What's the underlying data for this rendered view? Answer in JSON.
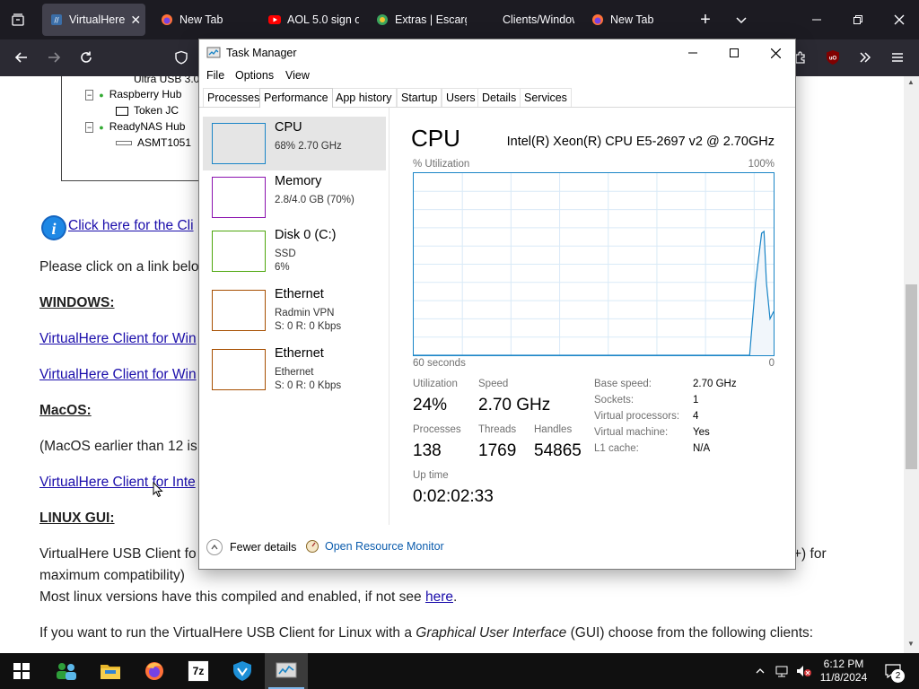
{
  "browser": {
    "tabs": [
      {
        "label": "VirtualHere",
        "icon": "virtualhere-icon",
        "active": true
      },
      {
        "label": "New Tab",
        "icon": "firefox-icon"
      },
      {
        "label": "AOL 5.0 sign o",
        "icon": "youtube-icon"
      },
      {
        "label": "Extras | Escarg",
        "icon": "escargot-icon"
      },
      {
        "label": "Clients/Windows ·",
        "icon": ""
      },
      {
        "label": "New Tab",
        "icon": "firefox-icon"
      }
    ]
  },
  "page": {
    "tree": [
      {
        "label": "Ultra USB 3.0",
        "indent": 2
      },
      {
        "label": "Raspberry Hub",
        "indent": 1
      },
      {
        "label": "Token JC",
        "indent": 2
      },
      {
        "label": "ReadyNAS Hub",
        "indent": 1
      },
      {
        "label": "ASMT1051",
        "indent": 2
      }
    ],
    "info_link": "Click here for the Cli",
    "intro": "Please click on a link belo",
    "windows_heading": "WINDOWS:",
    "win_link1": "VirtualHere Client for Win",
    "win_link2": "VirtualHere Client for Win",
    "mac_heading": "MacOS:",
    "mac_note": "(MacOS earlier than 12 is",
    "mac_link": "VirtualHere Client for Inte",
    "linux_heading": "LINUX GUI:",
    "linux_line1_start": "VirtualHere USB Client fo",
    "linux_line1_end": "+) for",
    "linux_line2": "maximum compatibility)",
    "linux_line3": "Most linux versions have this compiled and enabled, if not see",
    "here_link": "here",
    "linux_line3_end": ".",
    "gui_line_a": "If you want to run the VirtualHere USB Client for Linux with a",
    "gui_line_em": "Graphical User Interface",
    "gui_line_b": "(GUI) choose from the following clients:"
  },
  "taskmanager": {
    "title": "Task Manager",
    "menu": [
      "File",
      "Options",
      "View"
    ],
    "tabs": [
      "Processes",
      "Performance",
      "App history",
      "Startup",
      "Users",
      "Details",
      "Services"
    ],
    "selected_tab": "Performance",
    "sidebar": [
      {
        "name": "CPU",
        "sub1": "68%  2.70 GHz",
        "sub2": "",
        "color": "#1a85c7",
        "selected": true
      },
      {
        "name": "Memory",
        "sub1": "2.8/4.0 GB (70%)",
        "sub2": "",
        "color": "#8b12ae"
      },
      {
        "name": "Disk 0 (C:)",
        "sub1": "SSD",
        "sub2": "6%",
        "color": "#4da60c"
      },
      {
        "name": "Ethernet",
        "sub1": "Radmin VPN",
        "sub2": "S: 0  R: 0 Kbps",
        "color": "#a74f01"
      },
      {
        "name": "Ethernet",
        "sub1": "Ethernet",
        "sub2": "S: 0  R: 0 Kbps",
        "color": "#a74f01"
      }
    ],
    "cpu": {
      "heading": "CPU",
      "model": "Intel(R) Xeon(R) CPU E5-2697 v2 @ 2.70GHz",
      "graph_label": "% Utilization",
      "graph_max": "100%",
      "graph_left": "60 seconds",
      "graph_right": "0",
      "utilization_label": "Utilization",
      "utilization": "24%",
      "speed_label": "Speed",
      "speed": "2.70 GHz",
      "processes_label": "Processes",
      "processes": "138",
      "threads_label": "Threads",
      "threads": "1769",
      "handles_label": "Handles",
      "handles": "54865",
      "uptime_label": "Up time",
      "uptime": "0:02:02:33",
      "details": [
        {
          "k": "Base speed:",
          "v": "2.70 GHz"
        },
        {
          "k": "Sockets:",
          "v": "1"
        },
        {
          "k": "Virtual processors:",
          "v": "4"
        },
        {
          "k": "Virtual machine:",
          "v": "Yes"
        },
        {
          "k": "L1 cache:",
          "v": "N/A"
        }
      ]
    },
    "fewer_details": "Fewer details",
    "open_monitor": "Open Resource Monitor"
  },
  "chart_data": {
    "type": "area",
    "xlabel": "60 seconds",
    "ylabel": "% Utilization",
    "ylim": [
      0,
      100
    ],
    "x": [
      60,
      56,
      4,
      3,
      2,
      1.6,
      1.2,
      0.6,
      0
    ],
    "values": [
      0,
      0,
      0,
      40,
      67,
      68,
      40,
      20,
      24
    ],
    "grid": true
  },
  "taskbar": {
    "time": "6:12 PM",
    "date": "11/8/2024",
    "notif_count": "2"
  }
}
